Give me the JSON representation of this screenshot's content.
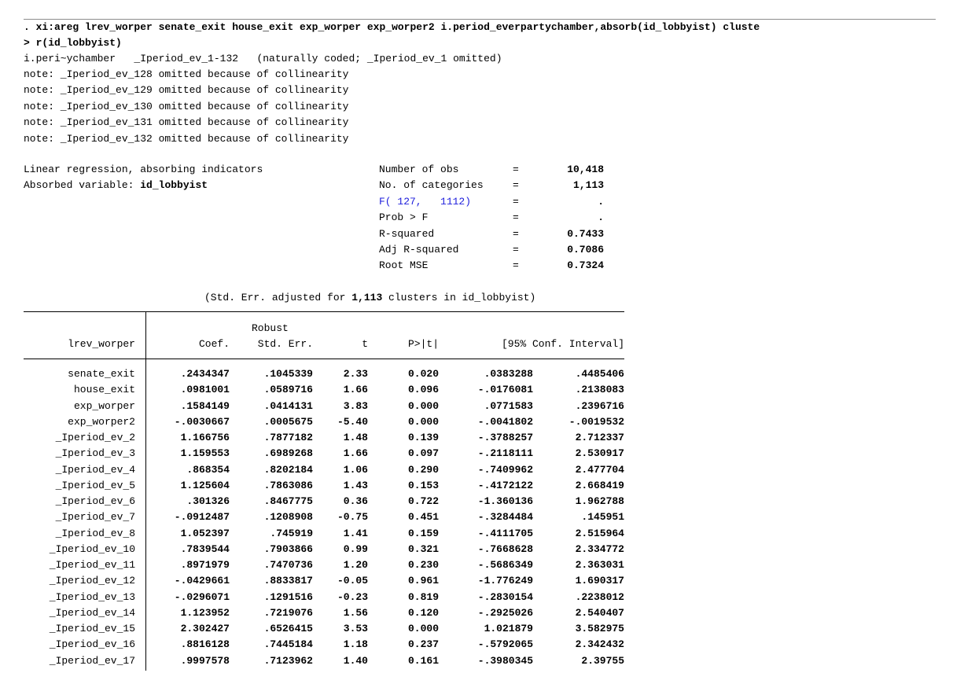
{
  "command": {
    "line1": ". xi:areg lrev_worper senate_exit house_exit exp_worper exp_worper2 i.period_everpartychamber,absorb(id_lobbyist) cluste",
    "line2": "> r(id_lobbyist)"
  },
  "xi_line": "i.peri~ychamber   _Iperiod_ev_1-132   (naturally coded; _Iperiod_ev_1 omitted)",
  "notes": [
    "note: _Iperiod_ev_128 omitted because of collinearity",
    "note: _Iperiod_ev_129 omitted because of collinearity",
    "note: _Iperiod_ev_130 omitted because of collinearity",
    "note: _Iperiod_ev_131 omitted because of collinearity",
    "note: _Iperiod_ev_132 omitted because of collinearity"
  ],
  "model": {
    "title": "Linear regression, absorbing indicators",
    "absorbed_label": "Absorbed variable: ",
    "absorbed_var": "id_lobbyist"
  },
  "stats": [
    {
      "label": "Number of obs",
      "eq": "=",
      "value": "10,418",
      "link": false
    },
    {
      "label": "No. of categories",
      "eq": "=",
      "value": "1,113",
      "link": false
    },
    {
      "label": "F( 127,   1112)",
      "eq": "=",
      "value": ".",
      "link": true
    },
    {
      "label": "Prob > F",
      "eq": "=",
      "value": ".",
      "link": false
    },
    {
      "label": "R-squared",
      "eq": "=",
      "value": "0.7433",
      "link": false
    },
    {
      "label": "Adj R-squared",
      "eq": "=",
      "value": "0.7086",
      "link": false
    },
    {
      "label": "Root MSE",
      "eq": "=",
      "value": "0.7324",
      "link": false
    }
  ],
  "se_note": {
    "prefix": "(Std. Err. adjusted for ",
    "clusters": "1,113",
    "suffix": " clusters in id_lobbyist)"
  },
  "table": {
    "header_top": {
      "robust": "Robust"
    },
    "headers": {
      "depvar": "lrev_worper",
      "coef": "Coef.",
      "se": "Std. Err.",
      "t": "t",
      "p": "P>|t|",
      "ci": "[95% Conf. Interval]"
    },
    "rows": [
      {
        "name": "senate_exit",
        "coef": ".2434347",
        "se": ".1045339",
        "t": "2.33",
        "p": "0.020",
        "lo": ".0383288",
        "hi": ".4485406"
      },
      {
        "name": "house_exit",
        "coef": ".0981001",
        "se": ".0589716",
        "t": "1.66",
        "p": "0.096",
        "lo": "-.0176081",
        "hi": ".2138083"
      },
      {
        "name": "exp_worper",
        "coef": ".1584149",
        "se": ".0414131",
        "t": "3.83",
        "p": "0.000",
        "lo": ".0771583",
        "hi": ".2396716"
      },
      {
        "name": "exp_worper2",
        "coef": "-.0030667",
        "se": ".0005675",
        "t": "-5.40",
        "p": "0.000",
        "lo": "-.0041802",
        "hi": "-.0019532"
      },
      {
        "name": "_Iperiod_ev_2",
        "coef": "1.166756",
        "se": ".7877182",
        "t": "1.48",
        "p": "0.139",
        "lo": "-.3788257",
        "hi": "2.712337"
      },
      {
        "name": "_Iperiod_ev_3",
        "coef": "1.159553",
        "se": ".6989268",
        "t": "1.66",
        "p": "0.097",
        "lo": "-.2118111",
        "hi": "2.530917"
      },
      {
        "name": "_Iperiod_ev_4",
        "coef": ".868354",
        "se": ".8202184",
        "t": "1.06",
        "p": "0.290",
        "lo": "-.7409962",
        "hi": "2.477704"
      },
      {
        "name": "_Iperiod_ev_5",
        "coef": "1.125604",
        "se": ".7863086",
        "t": "1.43",
        "p": "0.153",
        "lo": "-.4172122",
        "hi": "2.668419"
      },
      {
        "name": "_Iperiod_ev_6",
        "coef": ".301326",
        "se": ".8467775",
        "t": "0.36",
        "p": "0.722",
        "lo": "-1.360136",
        "hi": "1.962788"
      },
      {
        "name": "_Iperiod_ev_7",
        "coef": "-.0912487",
        "se": ".1208908",
        "t": "-0.75",
        "p": "0.451",
        "lo": "-.3284484",
        "hi": ".145951"
      },
      {
        "name": "_Iperiod_ev_8",
        "coef": "1.052397",
        "se": ".745919",
        "t": "1.41",
        "p": "0.159",
        "lo": "-.4111705",
        "hi": "2.515964"
      },
      {
        "name": "_Iperiod_ev_10",
        "coef": ".7839544",
        "se": ".7903866",
        "t": "0.99",
        "p": "0.321",
        "lo": "-.7668628",
        "hi": "2.334772"
      },
      {
        "name": "_Iperiod_ev_11",
        "coef": ".8971979",
        "se": ".7470736",
        "t": "1.20",
        "p": "0.230",
        "lo": "-.5686349",
        "hi": "2.363031"
      },
      {
        "name": "_Iperiod_ev_12",
        "coef": "-.0429661",
        "se": ".8833817",
        "t": "-0.05",
        "p": "0.961",
        "lo": "-1.776249",
        "hi": "1.690317"
      },
      {
        "name": "_Iperiod_ev_13",
        "coef": "-.0296071",
        "se": ".1291516",
        "t": "-0.23",
        "p": "0.819",
        "lo": "-.2830154",
        "hi": ".2238012"
      },
      {
        "name": "_Iperiod_ev_14",
        "coef": "1.123952",
        "se": ".7219076",
        "t": "1.56",
        "p": "0.120",
        "lo": "-.2925026",
        "hi": "2.540407"
      },
      {
        "name": "_Iperiod_ev_15",
        "coef": "2.302427",
        "se": ".6526415",
        "t": "3.53",
        "p": "0.000",
        "lo": "1.021879",
        "hi": "3.582975"
      },
      {
        "name": "_Iperiod_ev_16",
        "coef": ".8816128",
        "se": ".7445184",
        "t": "1.18",
        "p": "0.237",
        "lo": "-.5792065",
        "hi": "2.342432"
      },
      {
        "name": "_Iperiod_ev_17",
        "coef": ".9997578",
        "se": ".7123962",
        "t": "1.40",
        "p": "0.161",
        "lo": "-.3980345",
        "hi": "2.39755"
      }
    ]
  }
}
